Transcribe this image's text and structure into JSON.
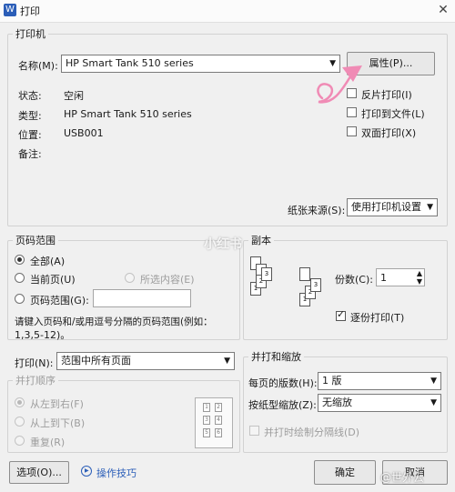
{
  "window": {
    "title": "打印",
    "app_icon": "W"
  },
  "printer": {
    "group_label": "打印机",
    "name_label": "名称(M):",
    "name_value": "HP Smart Tank 510 series",
    "properties_button": "属性(P)...",
    "status_label": "状态:",
    "status_value": "空闲",
    "type_label": "类型:",
    "type_value": "HP Smart Tank 510 series",
    "location_label": "位置:",
    "location_value": "USB001",
    "comment_label": "备注:",
    "reverse_print": "反片打印(I)",
    "print_to_file": "打印到文件(L)",
    "duplex": "双面打印(X)",
    "paper_source_label": "纸张来源(S):",
    "paper_source_value": "使用打印机设置"
  },
  "page_range": {
    "group_label": "页码范围",
    "all": "全部(A)",
    "current_page": "当前页(U)",
    "selection": "所选内容(E)",
    "pages": "页码范围(G):",
    "hint_line1": "请键入页码和/或用逗号分隔的页码范围(例如：",
    "hint_line2": "1,3,5-12)。"
  },
  "copies": {
    "group_label": "副本",
    "count_label": "份数(C):",
    "count_value": "1",
    "collate": "逐份打印(T)"
  },
  "print_what": {
    "label": "打印(N):",
    "value": "范围中所有页面",
    "order_label": "并打顺序",
    "left_to_right": "从左到右(F)",
    "top_to_bottom": "从上到下(B)",
    "repeat": "重复(R)"
  },
  "zoom": {
    "group_label": "并打和缩放",
    "pages_per_sheet_label": "每页的版数(H):",
    "pages_per_sheet_value": "1 版",
    "scale_label": "按纸型缩放(Z):",
    "scale_value": "无缩放",
    "draw_borders": "并打时绘制分隔线(D)"
  },
  "footer": {
    "options_button": "选项(O)...",
    "tips_link": "操作技巧",
    "ok_button": "确定",
    "cancel_button": "取消"
  },
  "watermarks": {
    "center": "小红书",
    "corner": "@世外云"
  },
  "colors": {
    "accent": "#2b5eb8",
    "annotation": "#f08bb5"
  }
}
